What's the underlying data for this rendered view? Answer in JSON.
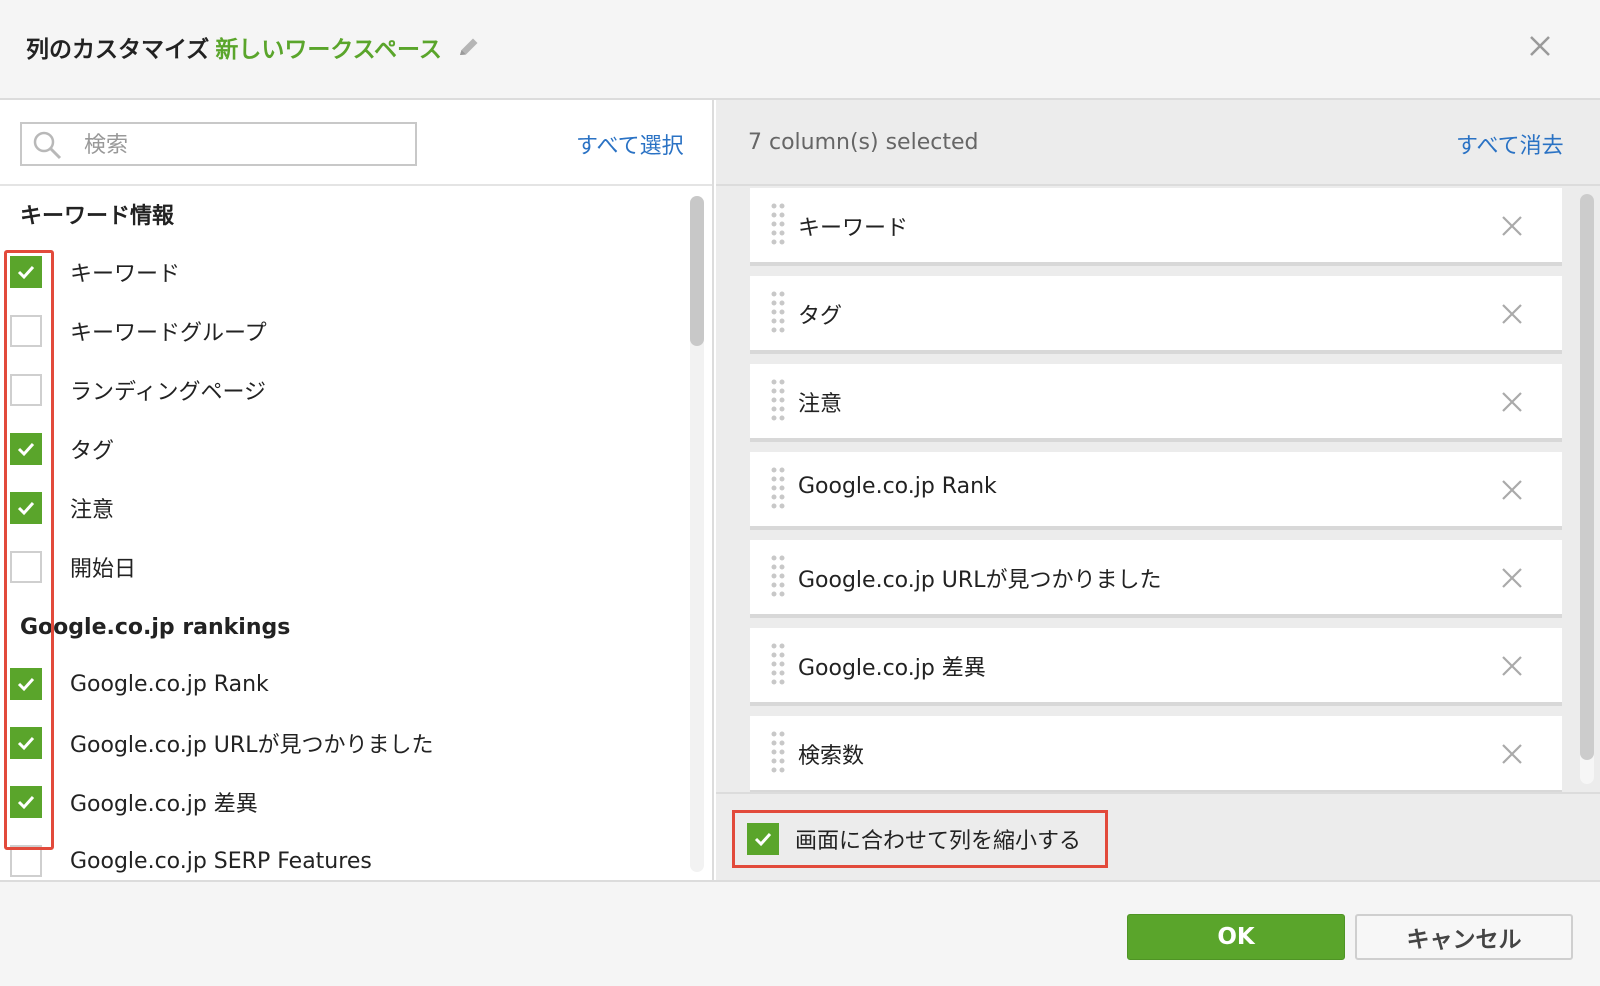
{
  "header": {
    "title": "列のカスタマイズ",
    "workspace_name": "新しいワークスペース"
  },
  "left_panel": {
    "search_placeholder": "検索",
    "select_all": "すべて選択",
    "groups": [
      {
        "title": "キーワード情報",
        "items": [
          {
            "label": "キーワード",
            "checked": true
          },
          {
            "label": "キーワードグループ",
            "checked": false
          },
          {
            "label": "ランディングページ",
            "checked": false
          },
          {
            "label": "タグ",
            "checked": true
          },
          {
            "label": "注意",
            "checked": true
          },
          {
            "label": "開始日",
            "checked": false
          }
        ]
      },
      {
        "title": "Google.co.jp rankings",
        "items": [
          {
            "label": "Google.co.jp Rank",
            "checked": true
          },
          {
            "label": "Google.co.jp URLが見つかりました",
            "checked": true
          },
          {
            "label": "Google.co.jp 差異",
            "checked": true
          },
          {
            "label": "Google.co.jp SERP Features",
            "checked": false
          }
        ]
      }
    ]
  },
  "right_panel": {
    "selected_count": "7 column(s) selected",
    "clear_all": "すべて消去",
    "selected": [
      "キーワード",
      "タグ",
      "注意",
      "Google.co.jp Rank",
      "Google.co.jp URLが見つかりました",
      "Google.co.jp 差異",
      "検索数"
    ],
    "fit_to_screen": {
      "label": "画面に合わせて列を縮小する",
      "checked": true
    }
  },
  "footer": {
    "ok": "OK",
    "cancel": "キャンセル"
  },
  "colors": {
    "accent_green": "#5aa52b",
    "link_blue": "#2a72c4",
    "highlight_red": "#e24a3b"
  }
}
